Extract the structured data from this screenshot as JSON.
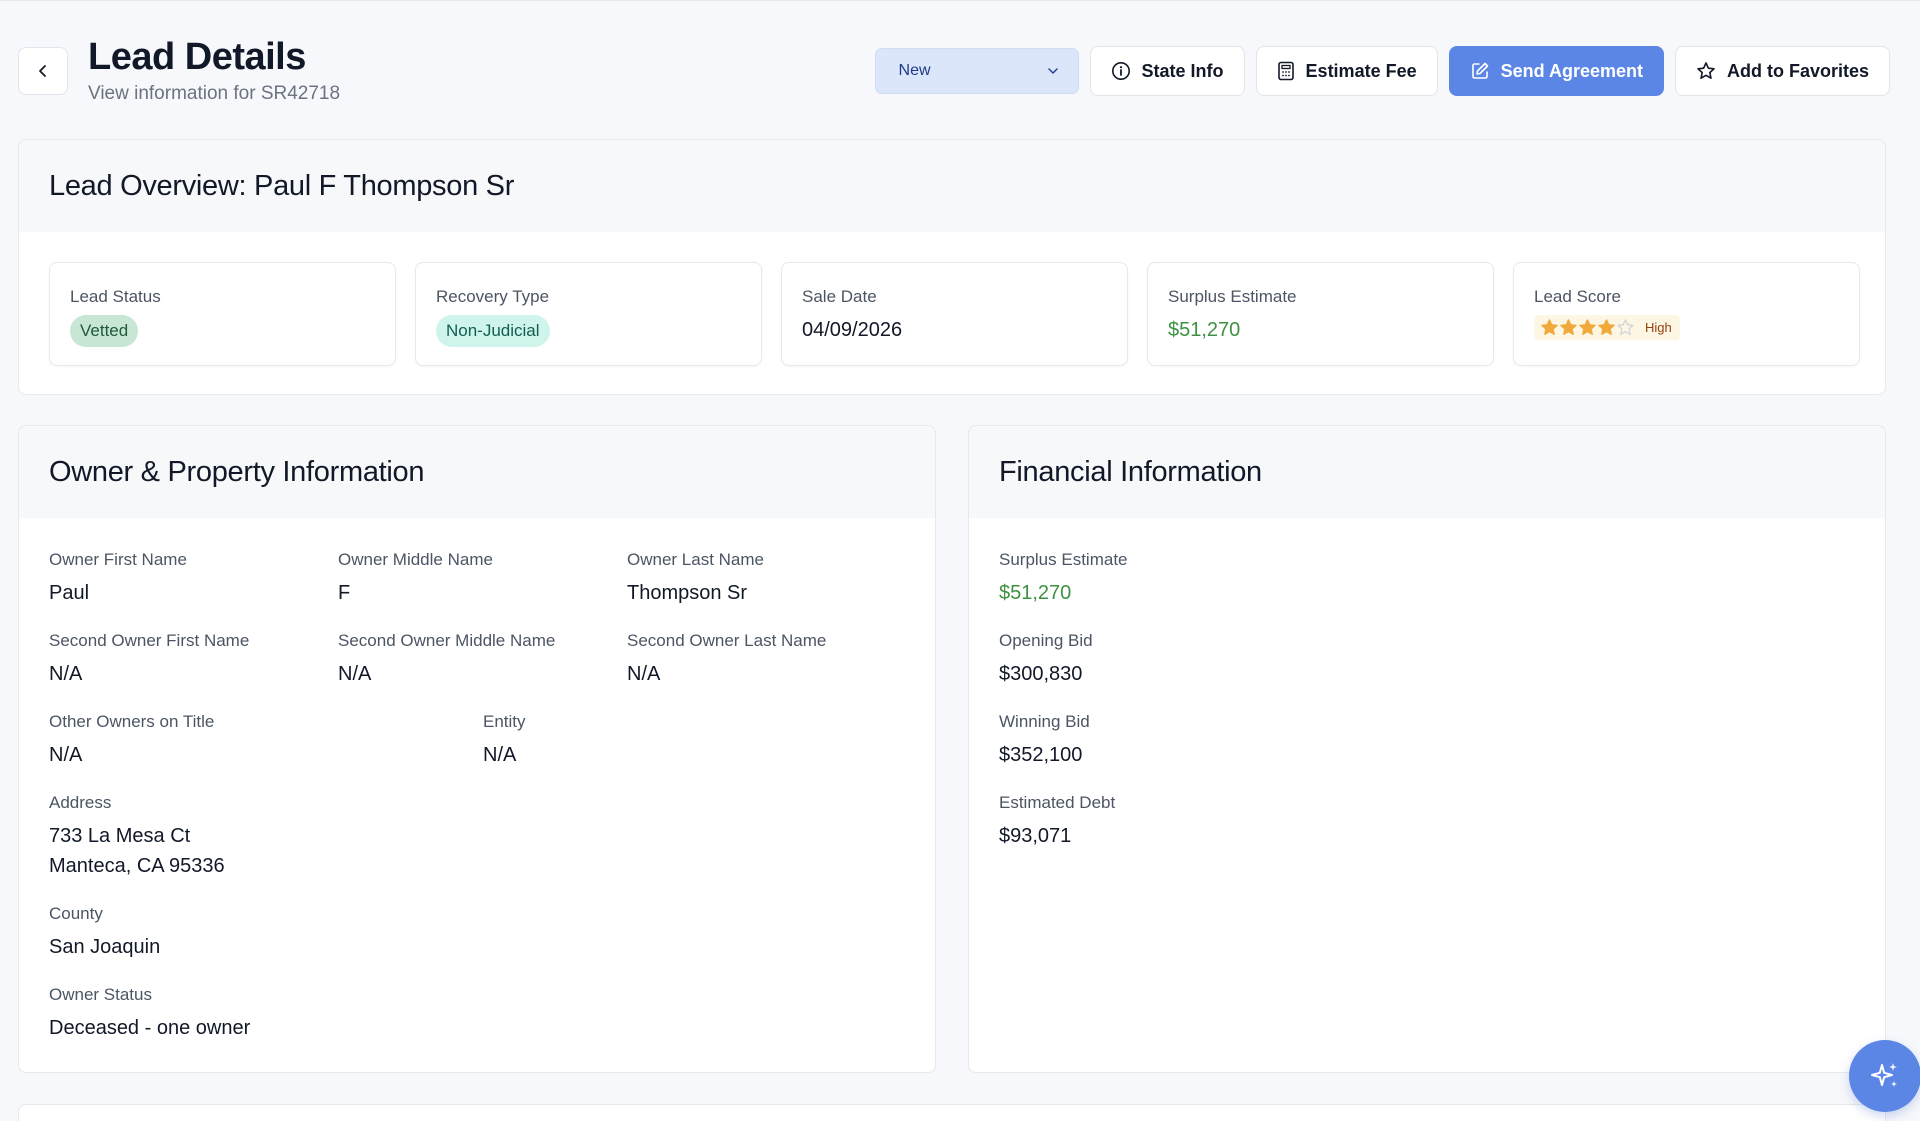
{
  "header": {
    "title": "Lead Details",
    "subtitle": "View information for SR42718",
    "status_select": "New",
    "state_info": "State Info",
    "estimate_fee": "Estimate Fee",
    "send_agreement": "Send Agreement",
    "add_favorites": "Add to Favorites"
  },
  "overview": {
    "title": "Lead Overview: Paul F Thompson Sr",
    "lead_status": {
      "label": "Lead Status",
      "value": "Vetted"
    },
    "recovery_type": {
      "label": "Recovery Type",
      "value": "Non-Judicial"
    },
    "sale_date": {
      "label": "Sale Date",
      "value": "04/09/2026"
    },
    "surplus_estimate": {
      "label": "Surplus Estimate",
      "value": "$51,270"
    },
    "lead_score": {
      "label": "Lead Score",
      "stars": 4,
      "max_stars": 5,
      "value": "High"
    }
  },
  "owner": {
    "title": "Owner & Property Information",
    "first_name": {
      "label": "Owner First Name",
      "value": "Paul"
    },
    "middle_name": {
      "label": "Owner Middle Name",
      "value": "F"
    },
    "last_name": {
      "label": "Owner Last Name",
      "value": "Thompson Sr"
    },
    "second_first": {
      "label": "Second Owner First Name",
      "value": "N/A"
    },
    "second_middle": {
      "label": "Second Owner Middle Name",
      "value": "N/A"
    },
    "second_last": {
      "label": "Second Owner Last Name",
      "value": "N/A"
    },
    "other_owners": {
      "label": "Other Owners on Title",
      "value": "N/A"
    },
    "entity": {
      "label": "Entity",
      "value": "N/A"
    },
    "address": {
      "label": "Address",
      "line1": "733 La Mesa Ct",
      "line2": "Manteca, CA 95336"
    },
    "county": {
      "label": "County",
      "value": "San Joaquin"
    },
    "owner_status": {
      "label": "Owner Status",
      "value": "Deceased - one owner"
    }
  },
  "financial": {
    "title": "Financial Information",
    "surplus_estimate": {
      "label": "Surplus Estimate",
      "value": "$51,270"
    },
    "opening_bid": {
      "label": "Opening Bid",
      "value": "$300,830"
    },
    "winning_bid": {
      "label": "Winning Bid",
      "value": "$352,100"
    },
    "estimated_debt": {
      "label": "Estimated Debt",
      "value": "$93,071"
    }
  },
  "colors": {
    "accent": "#5b86e5",
    "success": "#3f9142",
    "star": "#f0a93b"
  }
}
